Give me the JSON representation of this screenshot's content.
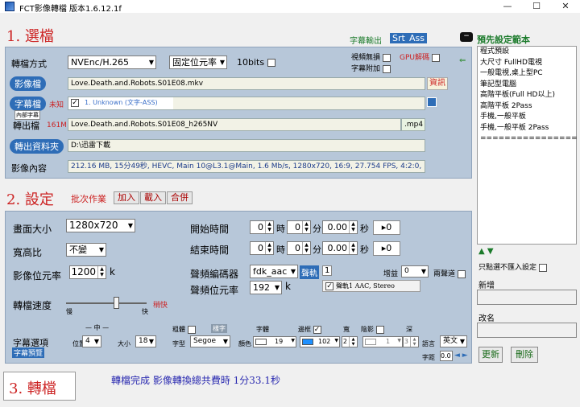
{
  "window": {
    "title": "FCT影像轉檔 版本1.6.12.1f",
    "minimize": "—",
    "maximize": "☐",
    "close": "✕"
  },
  "section1": {
    "title": "1. 選檔",
    "subtitle_output_label": "字幕輸出",
    "srt_label": "Srt",
    "ass_label": "Ass",
    "format_label": "轉檔方式",
    "encoder_value": "NVEnc/H.265",
    "rate_mode_value": "固定位元率",
    "bit10_label": "10bits",
    "seamless_label": "視頻無損",
    "gpu_decode_label": "GPU解碼",
    "subtitle_attach_label": "字幕附加",
    "video_pill": "影像檔",
    "video_file": "Love.Death.and.Robots.S01E08.mkv",
    "info_button": "資訊",
    "subtitle_pill": "字幕檔",
    "subtitle_unknown": "未知",
    "subtitle_track": "1. Unknown (文字-ASS)",
    "subtitle_tooltip": "內部字幕",
    "output_label": "轉出檔",
    "output_size": "161M",
    "output_file": "Love.Death.and.Robots.S01E08_h265NV",
    "output_ext": ".mp4",
    "output_folder_pill": "轉出資料夾",
    "output_folder": "D:\\迅雷下載",
    "video_info_label": "影像內容",
    "video_info": "212.16 MB, 15分49秒, HEVC, Main 10@L3.1@Main, 1.6 Mb/s, 1280x720, 16:9, 27.754 FPS, 4:2:0, 10 bits"
  },
  "section2": {
    "title": "2. 設定",
    "batch_label": "批次作業",
    "add_button": "加入",
    "load_button": "載入",
    "merge_button": "合併",
    "size_label": "畫面大小",
    "size_value": "1280x720",
    "aspect_label": "寬高比",
    "aspect_value": "不變",
    "bitrate_label": "影像位元率",
    "bitrate_value": "1200",
    "bitrate_unit": "k",
    "speed_label": "轉檔速度",
    "speed_slow": "慢",
    "speed_fast": "快",
    "speed_value_text": "稍快",
    "speed_level": 0.62,
    "start_label": "開始時間",
    "end_label": "結束時間",
    "hour_unit": "時",
    "min_unit": "分",
    "sec_unit": "秒",
    "start_h": "0",
    "start_m": "0",
    "start_s": "0.00",
    "end_h": "0",
    "end_m": "0",
    "end_s": "0.00",
    "reset_label": "▸0",
    "audio_codec_label": "聲頻編碼器",
    "audio_codec_value": "fdk_aac",
    "audio_track_pill": "聲軌",
    "audio_track_num": "1",
    "gain_label": "增益",
    "gain_value": "0",
    "dual_label": "兩聲道",
    "audio_bitrate_label": "聲頻位元率",
    "audio_bitrate_value": "192",
    "audio_bitrate_unit": "k",
    "audio_track_item": "聲軌1 AAC, Stereo",
    "sub_options_label": "字幕選項",
    "sub_preview": "字幕預覽",
    "mid_label": "中",
    "position_label": "位置",
    "position_value": "4",
    "size_small_label": "大小",
    "font_size_value": "18",
    "bold_label": "粗體",
    "sample_label": "樣字",
    "font_label": "字型",
    "font_value": "Segoe",
    "color_label": "顏色",
    "font_color_value": "19",
    "font_prop_label": "字體",
    "border_label": "邊框",
    "border_value": "102",
    "width_label": "寬",
    "width_value": "2",
    "shadow_label": "陰影",
    "shadow_value": "1",
    "depth_label": "深",
    "depth_value": "3",
    "lang_label": "語言",
    "lang_value": "英文",
    "spacing_label": "字距",
    "spacing_value": "0.0"
  },
  "section3": {
    "title": "3. 轉檔",
    "status": "轉檔完成  影像轉換總共費時 1分33.1秒"
  },
  "sidebar": {
    "title": "預先設定範本",
    "presets": [
      "程式預設",
      "大尺寸 FullHD電視",
      "一般電視,桌上型PC",
      "筆記型電腦",
      "高階平板(Full HD以上)",
      "高階平板 2Pass",
      "手機,一般平板",
      "手機,一般平板  2Pass",
      "================"
    ],
    "arrows": "▲ ▼",
    "click_no_import": "只點選不匯入設定",
    "new_label": "新增",
    "rename_label": "改名",
    "update_button": "更新",
    "delete_button": "刪除"
  }
}
